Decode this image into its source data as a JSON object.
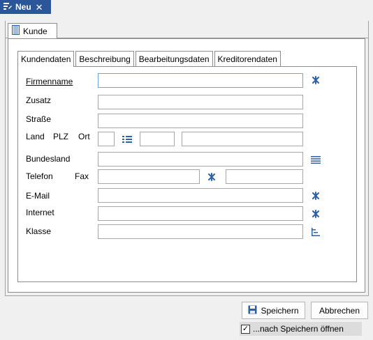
{
  "window": {
    "tab_title": "Neu",
    "close_glyph": "✕"
  },
  "outer_tabs": [
    {
      "label": "Kunde"
    }
  ],
  "inner_tabs": [
    {
      "label": "Kundendaten",
      "active": true
    },
    {
      "label": "Beschreibung",
      "active": false
    },
    {
      "label": "Bearbeitungsdaten",
      "active": false
    },
    {
      "label": "Kreditorendaten",
      "active": false
    }
  ],
  "form": {
    "firmenname_label": "Firmenname",
    "zusatz_label": "Zusatz",
    "strasse_label": "Straße",
    "land_label": "Land",
    "plz_label": "PLZ",
    "ort_label": "Ort",
    "bundesland_label": "Bundesland",
    "telefon_label": "Telefon",
    "fax_label": "Fax",
    "email_label": "E-Mail",
    "internet_label": "Internet",
    "klasse_label": "Klasse",
    "values": {
      "firmenname": "",
      "zusatz": "",
      "strasse": "",
      "land": "",
      "plz": "",
      "ort": "",
      "bundesland": "",
      "telefon": "",
      "fax": "",
      "email": "",
      "internet": "",
      "klasse": ""
    }
  },
  "footer": {
    "save_label": "Speichern",
    "cancel_label": "Abbrechen",
    "open_after_save_label": "...nach Speichern öffnen",
    "open_after_save_checked": true
  },
  "icons": {
    "title": "form-icon",
    "kunde_tab": "document-icon",
    "firmenname": "snowflake-icon",
    "plz_lookup": "list-icon",
    "bundesland": "lines-icon",
    "telefon": "snowflake-icon",
    "email": "snowflake-icon",
    "internet": "snowflake-icon",
    "klasse": "tree-icon",
    "save": "floppy-icon"
  },
  "colors": {
    "accent": "#2b579a",
    "icon_blue": "#2f5fa8",
    "focus_border": "#6aa6dd"
  }
}
